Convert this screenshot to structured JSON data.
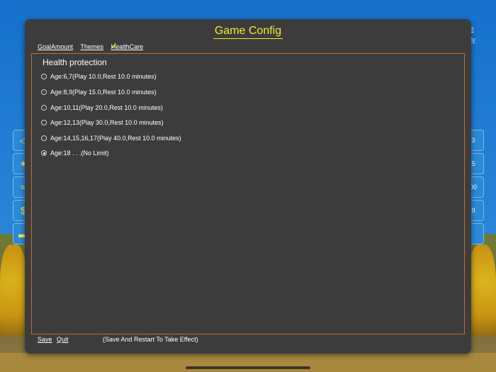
{
  "dialog": {
    "title": "Game Config",
    "tabs": [
      {
        "label": "GoalAmount"
      },
      {
        "label": "Themes"
      },
      {
        "label": "HealthCare"
      }
    ],
    "panel_title": "Health protection",
    "options": [
      {
        "label": "Age:6,7(Play 10.0,Rest 10.0 minutes)",
        "selected": false
      },
      {
        "label": "Age:8,9(Play 15.0,Rest 10.0 minutes)",
        "selected": false
      },
      {
        "label": "Age:10,11(Play 20.0,Rest 10.0 minutes)",
        "selected": false
      },
      {
        "label": "Age:12,13(Play 30.0,Rest 10.0 minutes)",
        "selected": false
      },
      {
        "label": "Age:14,15,16,17(Play 40.0,Rest 10.0 minutes)",
        "selected": false
      },
      {
        "label": "Age:18 . . .(No Limit)",
        "selected": true
      }
    ],
    "save_label": "Save",
    "quit_label": "Quit",
    "note": "(Save And Restart To Take Effect)"
  },
  "background": {
    "right_links": [
      "it",
      "ly"
    ],
    "right_tile_values": [
      "3",
      "5",
      "00",
      "9",
      ""
    ]
  }
}
